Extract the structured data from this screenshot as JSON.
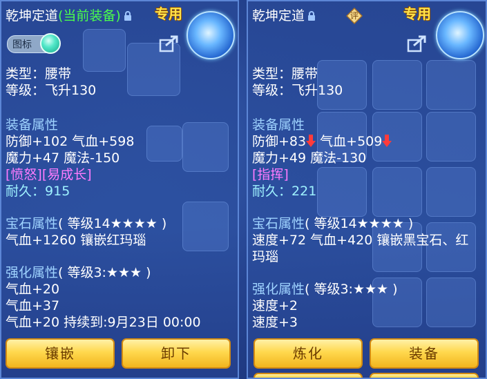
{
  "left": {
    "title": "乾坤定道",
    "equipped_tag": "(当前装备)",
    "special": "专用",
    "icon_toggle_label": "图标",
    "type_line": "类型：腰带",
    "level_line": "等级：飞升130",
    "equip_attr_header": "装备属性",
    "equip_attr_lines": [
      "防御+102 气血+598",
      "魔力+47 魔法-150"
    ],
    "special_effects": "[愤怒][易成长]",
    "durability_label": "耐久：",
    "durability_value": "915",
    "gem_header": "宝石属性",
    "gem_header_detail": "( 等级14★★★★ )",
    "gem_lines": [
      "气血+1260 镶嵌红玛瑙"
    ],
    "enhance_header": "强化属性",
    "enhance_header_detail": "( 等级3:★★★ )",
    "enhance_lines": [
      "气血+20",
      "气血+37",
      "气血+20    持续到:9月23日 00:00"
    ],
    "buttons": [
      "镶嵌",
      "卸下"
    ]
  },
  "right": {
    "title": "乾坤定道",
    "rating_badge": "评",
    "special": "专用",
    "type_line": "类型：腰带",
    "level_line": "等级：飞升130",
    "equip_attr_header": "装备属性",
    "equip_attr_line1_a": "防御+83",
    "equip_attr_line1_b": "气血+509",
    "equip_attr_line2": "魔力+49 魔法-130",
    "special_effects": "[指挥]",
    "durability_label": "耐久：",
    "durability_value": "221",
    "gem_header": "宝石属性",
    "gem_header_detail": "( 等级14★★★★ )",
    "gem_lines": [
      "速度+72 气血+420 镶嵌黑宝石、红",
      "玛瑙"
    ],
    "enhance_header": "强化属性",
    "enhance_header_detail": "( 等级3:★★★ )",
    "enhance_lines": [
      "速度+2",
      "速度+3"
    ],
    "buttons": [
      "炼化",
      "装备"
    ]
  },
  "colors": {
    "attr_header": "#9fd3ff",
    "equipped_tag": "#4bff4b",
    "special": "#ffe24a",
    "effect": "#ff7bff",
    "durability": "#9ff2ff",
    "down_arrow": "#ff3b3b",
    "button": "#ffd84d"
  },
  "icons": [
    "lock-icon",
    "share-icon",
    "down-arrow-icon",
    "rating-icon",
    "equipment-avatar-icon"
  ]
}
